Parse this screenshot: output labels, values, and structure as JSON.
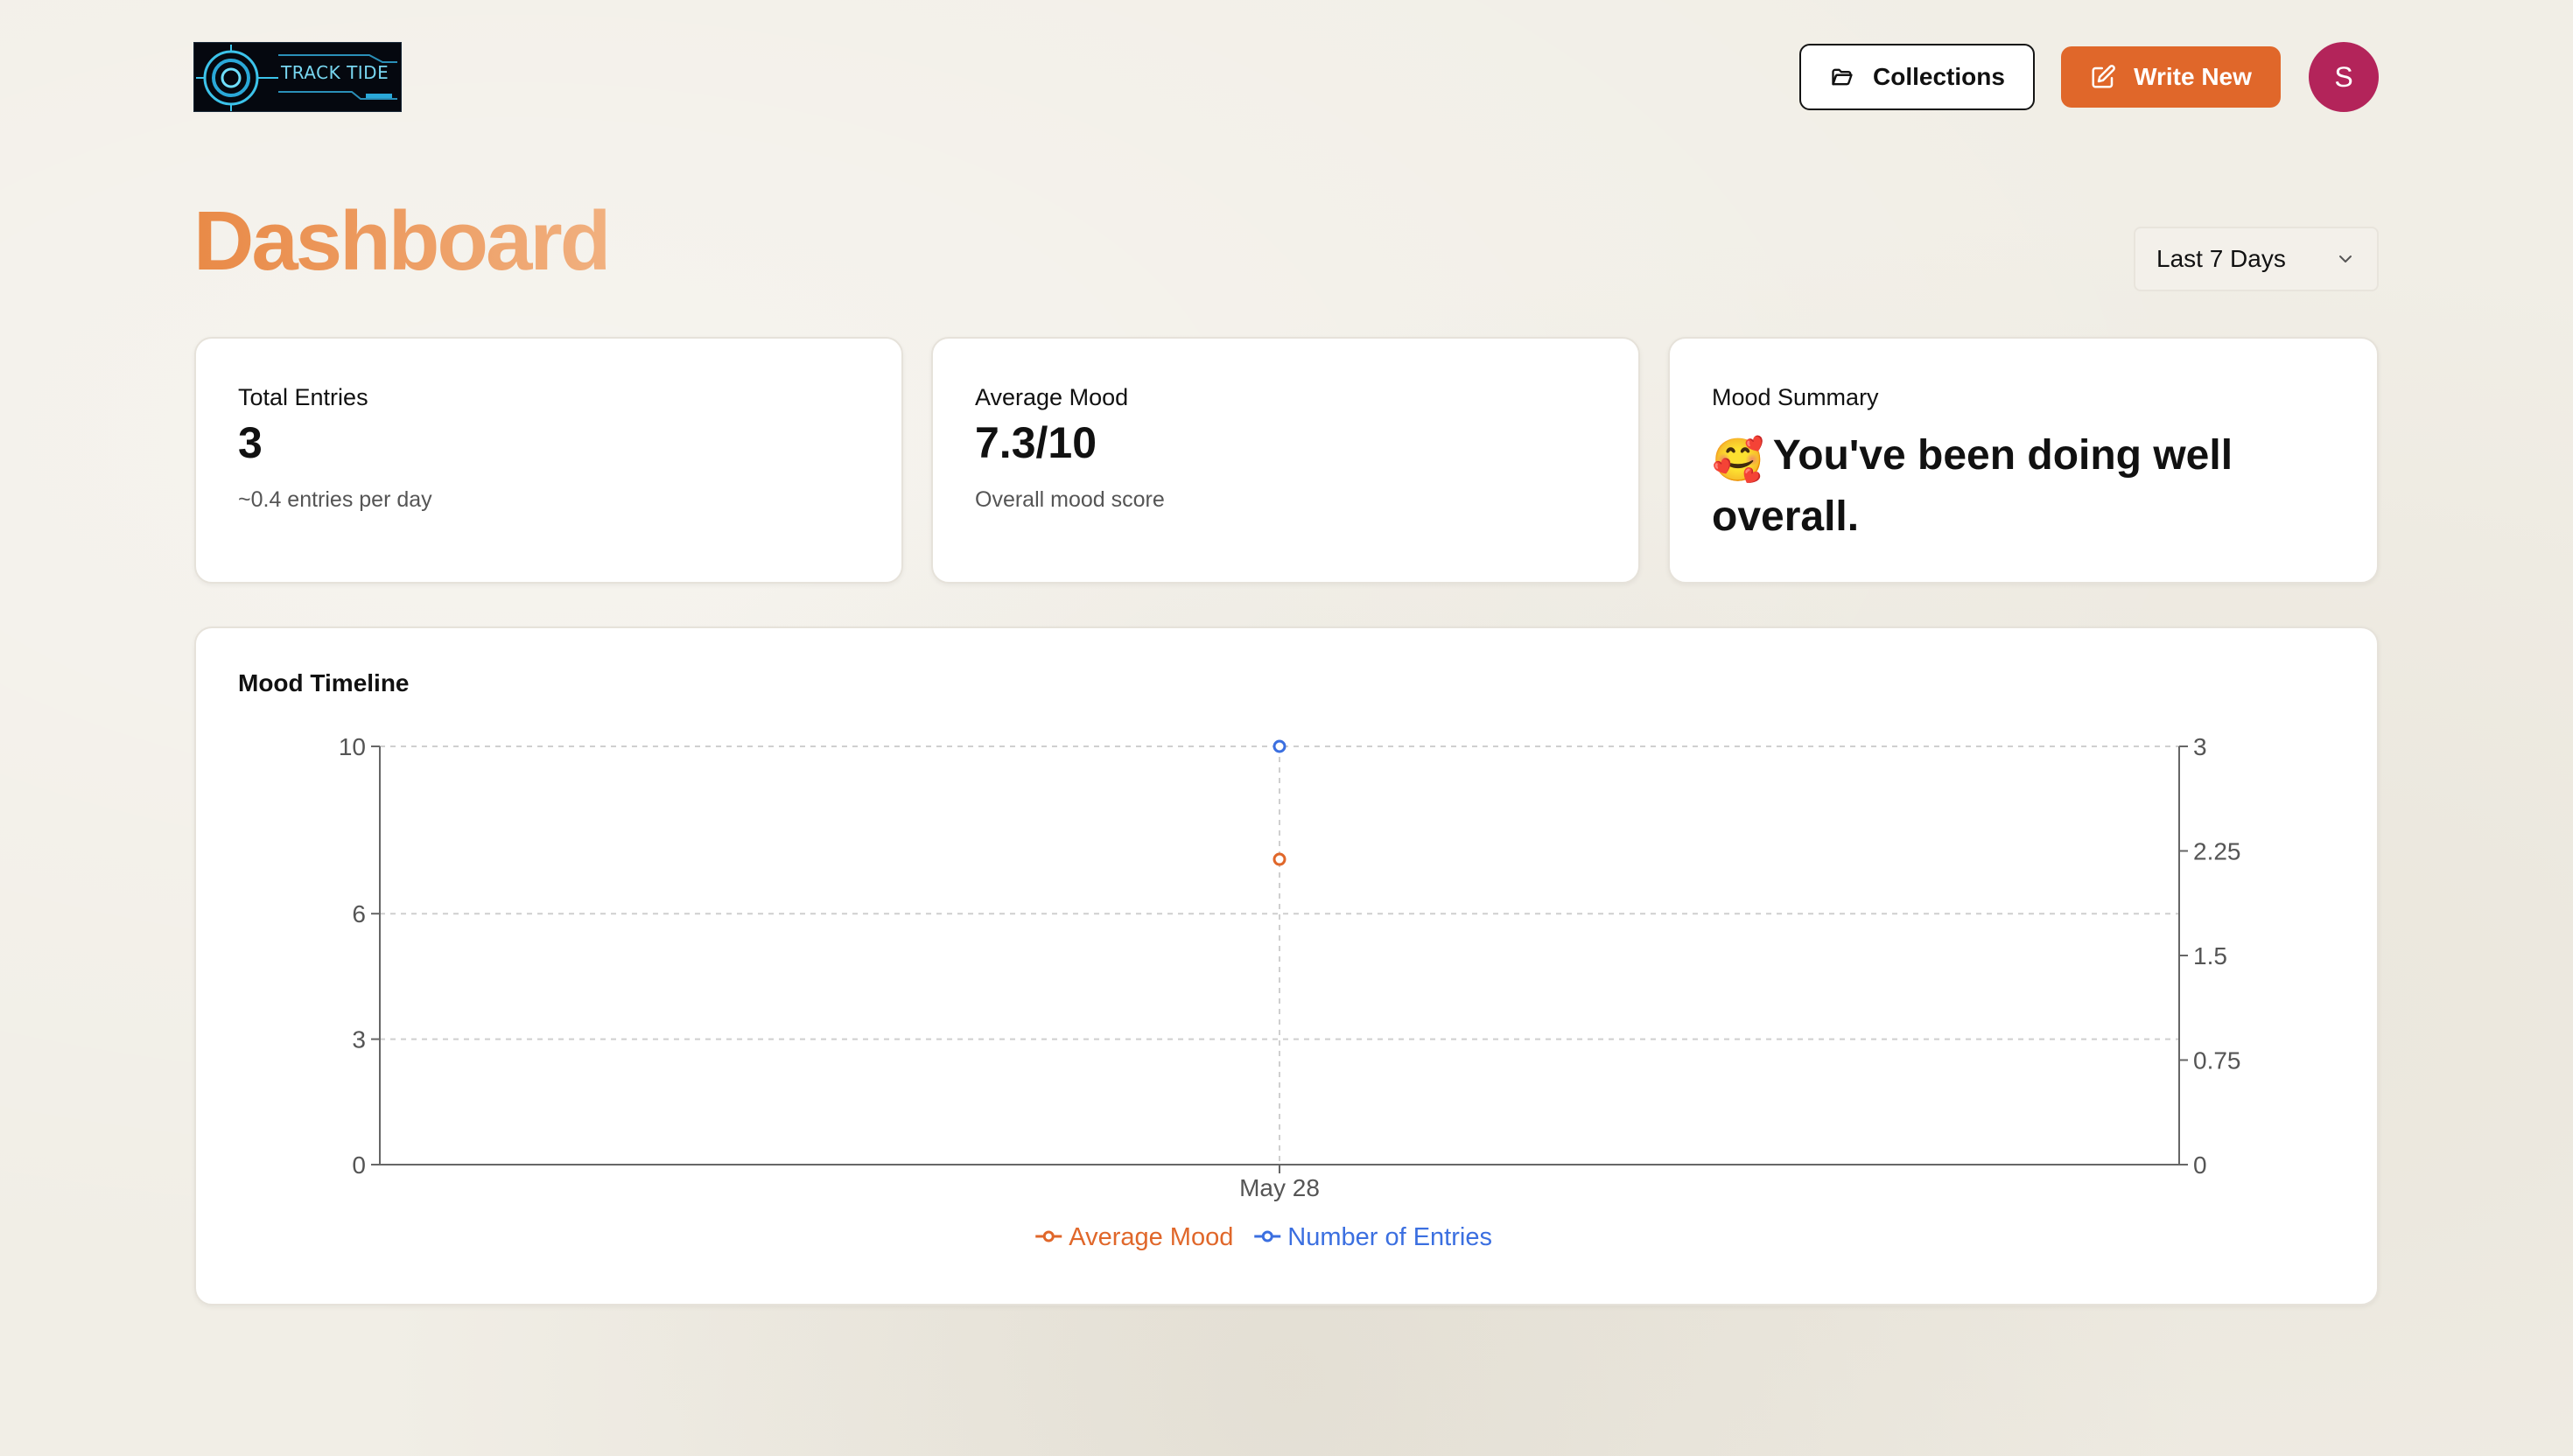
{
  "header": {
    "logo_text": "TRACK TIDE",
    "collections_label": "Collections",
    "write_label": "Write New",
    "avatar_initial": "S"
  },
  "page": {
    "title": "Dashboard",
    "range_label": "Last 7 Days"
  },
  "cards": {
    "total_entries": {
      "title": "Total Entries",
      "value": "3",
      "sub": "~0.4 entries per day"
    },
    "average_mood": {
      "title": "Average Mood",
      "value": "7.3/10",
      "sub": "Overall mood score"
    },
    "mood_summary": {
      "title": "Mood Summary",
      "emoji": "🥰",
      "text": "You've been doing well overall."
    }
  },
  "colors": {
    "accent": "#e0672a",
    "avatar": "#b3245a",
    "mood_series": "#e0672a",
    "entries_series": "#3b6fe0"
  },
  "chart_data": {
    "type": "line",
    "title": "Mood Timeline",
    "x": [
      "May 28"
    ],
    "series": [
      {
        "name": "Average Mood",
        "axis": "left",
        "values": [
          7.3
        ],
        "color": "#e0672a"
      },
      {
        "name": "Number of Entries",
        "axis": "right",
        "values": [
          3
        ],
        "color": "#3b6fe0"
      }
    ],
    "left_axis": {
      "ylim": [
        0,
        10
      ],
      "ticks": [
        0,
        3,
        6,
        10
      ]
    },
    "right_axis": {
      "ylim": [
        0,
        3
      ],
      "ticks": [
        0,
        0.75,
        1.5,
        2.25,
        3
      ]
    },
    "grid": true,
    "legend": "bottom-center"
  }
}
